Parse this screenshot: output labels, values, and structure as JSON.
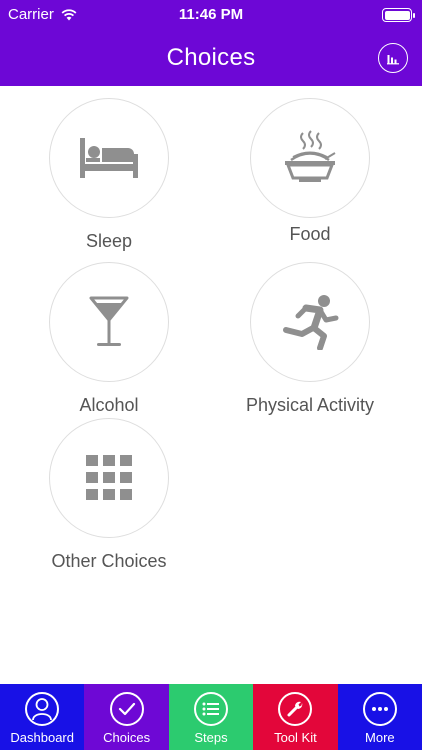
{
  "status_bar": {
    "carrier": "Carrier",
    "time": "11:46 PM"
  },
  "header": {
    "title": "Choices",
    "stats_icon": "bar-chart-icon"
  },
  "choices": [
    {
      "label": "Sleep",
      "icon": "bed-icon"
    },
    {
      "label": "Food",
      "icon": "bowl-icon"
    },
    {
      "label": "Alcohol",
      "icon": "martini-glass-icon"
    },
    {
      "label": "Physical Activity",
      "icon": "running-person-icon"
    },
    {
      "label": "Other Choices",
      "icon": "grid-icon"
    }
  ],
  "tabs": [
    {
      "label": "Dashboard",
      "icon": "person-icon",
      "color": "#1811e6"
    },
    {
      "label": "Choices",
      "icon": "checkmark-icon",
      "color": "#6e08d5",
      "selected": true
    },
    {
      "label": "Steps",
      "icon": "list-icon",
      "color": "#2ccb6f"
    },
    {
      "label": "Tool Kit",
      "icon": "wrench-icon",
      "color": "#e3063a"
    },
    {
      "label": "More",
      "icon": "ellipsis-icon",
      "color": "#1811e6"
    }
  ],
  "colors": {
    "header": "#6d07d6",
    "icon_gray": "#8f8f8f",
    "label_text": "#555555"
  }
}
